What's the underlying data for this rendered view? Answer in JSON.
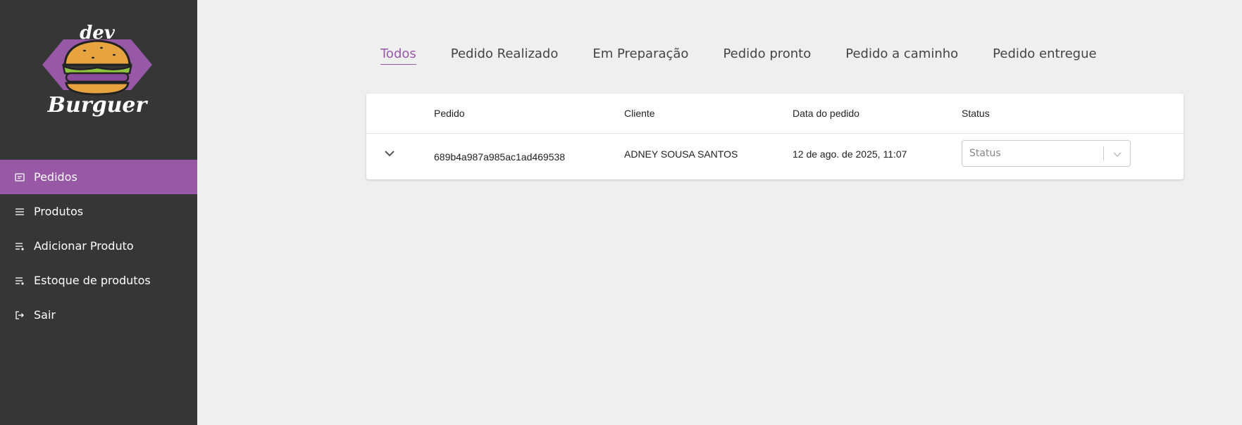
{
  "brand": {
    "top_word": "dev",
    "bottom_word": "Burguer"
  },
  "sidebar": {
    "items": [
      {
        "label": "Pedidos",
        "icon": "orders-icon",
        "active": true
      },
      {
        "label": "Produtos",
        "icon": "list-icon",
        "active": false
      },
      {
        "label": "Adicionar Produto",
        "icon": "playlist-add-icon",
        "active": false
      },
      {
        "label": "Estoque de produtos",
        "icon": "playlist-add-icon",
        "active": false
      },
      {
        "label": "Sair",
        "icon": "logout-icon",
        "active": false
      }
    ]
  },
  "tabs": [
    "Todos",
    "Pedido Realizado",
    "Em Preparação",
    "Pedido pronto",
    "Pedido a caminho",
    "Pedido entregue"
  ],
  "active_tab": "Todos",
  "table": {
    "headers": {
      "order": "Pedido",
      "client": "Cliente",
      "date": "Data do pedido",
      "status": "Status"
    },
    "rows": [
      {
        "order": "689b4a987a985ac1ad469538",
        "client": "ADNEY SOUSA SANTOS",
        "date": "12 de ago. de 2025, 11:07",
        "status_placeholder": "Status"
      }
    ]
  },
  "colors": {
    "accent": "#9758a6",
    "sidebar_bg": "#363636",
    "page_bg": "#efefef"
  }
}
